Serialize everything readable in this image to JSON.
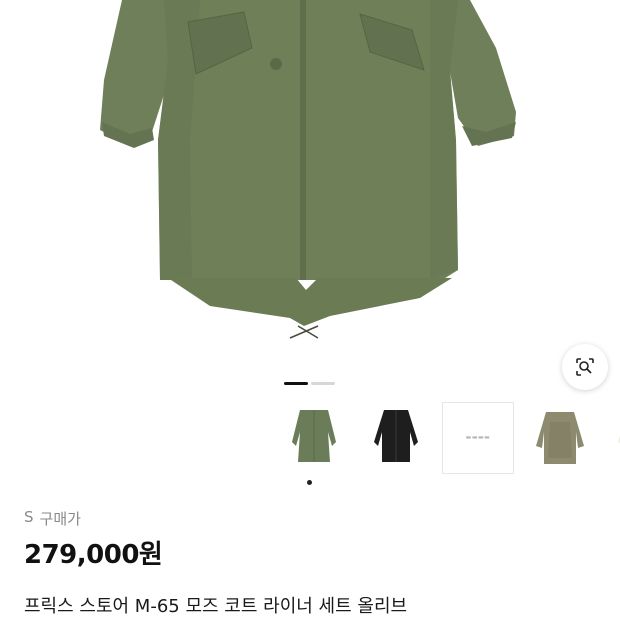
{
  "product": {
    "size_label": "S",
    "price_type_label": "구매가",
    "price": "279,000원",
    "title": "프릭스 스토어 M-65 모즈 코트 라이너 세트 올리브"
  },
  "gallery": {
    "current_page": 1,
    "page_count": 2,
    "thumbnail_count": 5,
    "selected_thumbnail": 1,
    "thumbnails": [
      {
        "name": "olive-coat",
        "color": "#6b7d58"
      },
      {
        "name": "black-coat",
        "color": "#1e1e1e"
      },
      {
        "name": "brand-card",
        "color": "#f2f2f2"
      },
      {
        "name": "olive-liner",
        "color": "#8c8a6f"
      },
      {
        "name": "ivory-coat",
        "color": "#f1ece2"
      }
    ]
  },
  "icons": {
    "lens": "lens-search-icon"
  },
  "colors": {
    "coat_olive": "#6b7d58",
    "accent_text": "#111111",
    "muted_text": "#8a8a8a"
  }
}
